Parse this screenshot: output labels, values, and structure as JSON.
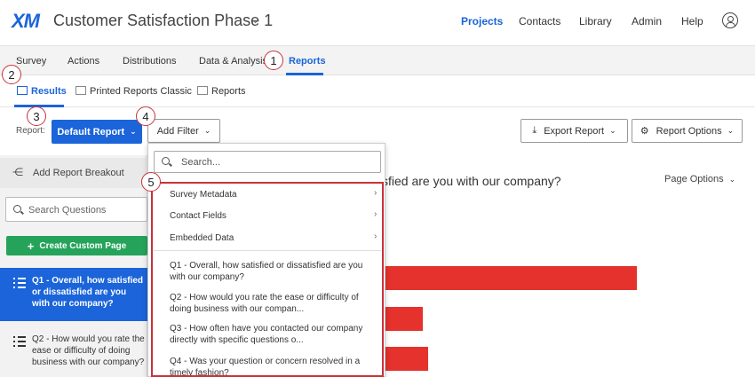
{
  "header": {
    "logo": "XM",
    "project_title": "Customer Satisfaction Phase 1",
    "nav": [
      "Projects",
      "Contacts",
      "Library",
      "Admin",
      "Help"
    ],
    "active_nav": "Projects"
  },
  "subnav": {
    "items": [
      "Survey",
      "Actions",
      "Distributions",
      "Data & Analysis",
      "Reports"
    ],
    "active": "Reports"
  },
  "thirdnav": {
    "items": [
      "Results",
      "Printed Reports Classic",
      "Reports"
    ],
    "active": "Results"
  },
  "toolbar": {
    "report_label": "Report:",
    "report_button": "Default Report",
    "add_filter": "Add Filter",
    "export_report": "Export Report",
    "report_options": "Report Options"
  },
  "left": {
    "breakout": "Add Report Breakout",
    "search_placeholder": "Search Questions",
    "create_page": "Create Custom Page",
    "questions": [
      "Q1 - Overall, how satisfied or dissatisfied are you with our company?",
      "Q2 - How would you rate the ease or difficulty of doing business with our company?"
    ]
  },
  "main": {
    "title": "sfied are you with our company?",
    "page_options": "Page Options",
    "bar_values": [
      1.0,
      0.19,
      0.21
    ]
  },
  "dropdown": {
    "search_placeholder": "Search...",
    "categories": [
      "Survey Metadata",
      "Contact Fields",
      "Embedded Data"
    ],
    "questions": [
      "Q1 - Overall, how satisfied or dissatisfied are you with our company?",
      "Q2 - How would you rate the ease or difficulty of doing business with our compan...",
      "Q3 - How often have you contacted our company directly with specific questions o...",
      "Q4 - Was your question or concern resolved in a timely fashion?"
    ]
  },
  "callouts": [
    "1",
    "2",
    "3",
    "4",
    "5"
  ],
  "colors": {
    "accent": "#1b64d9",
    "green": "#25a35a",
    "bar": "#e5322d",
    "callout": "#c8323a"
  }
}
